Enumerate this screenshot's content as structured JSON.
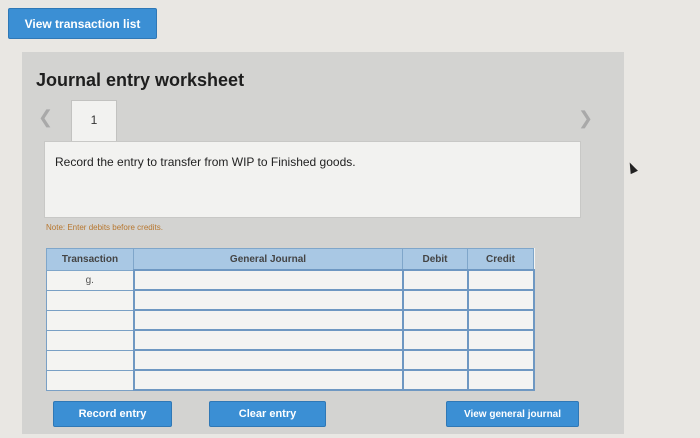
{
  "header": {
    "view_transaction_list": "View transaction list"
  },
  "worksheet": {
    "title": "Journal entry worksheet",
    "tab_number": "1",
    "instruction": "Record the entry to transfer from WIP to Finished goods.",
    "note": "Note: Enter debits before credits."
  },
  "table": {
    "headers": [
      "Transaction",
      "General Journal",
      "Debit",
      "Credit"
    ],
    "rows": [
      {
        "transaction": "g.",
        "account": "",
        "debit": "",
        "credit": ""
      },
      {
        "transaction": "",
        "account": "",
        "debit": "",
        "credit": ""
      },
      {
        "transaction": "",
        "account": "",
        "debit": "",
        "credit": ""
      },
      {
        "transaction": "",
        "account": "",
        "debit": "",
        "credit": ""
      },
      {
        "transaction": "",
        "account": "",
        "debit": "",
        "credit": ""
      },
      {
        "transaction": "",
        "account": "",
        "debit": "",
        "credit": ""
      }
    ]
  },
  "buttons": {
    "record": "Record entry",
    "clear": "Clear entry",
    "view_general": "View general journal"
  },
  "icons": {
    "prev": "chevron-left-icon",
    "next": "chevron-right-icon",
    "pointer": "cursor-icon"
  },
  "colors": {
    "accent": "#3b8fd4",
    "header": "#a9c8e4",
    "note": "#b7772f"
  }
}
